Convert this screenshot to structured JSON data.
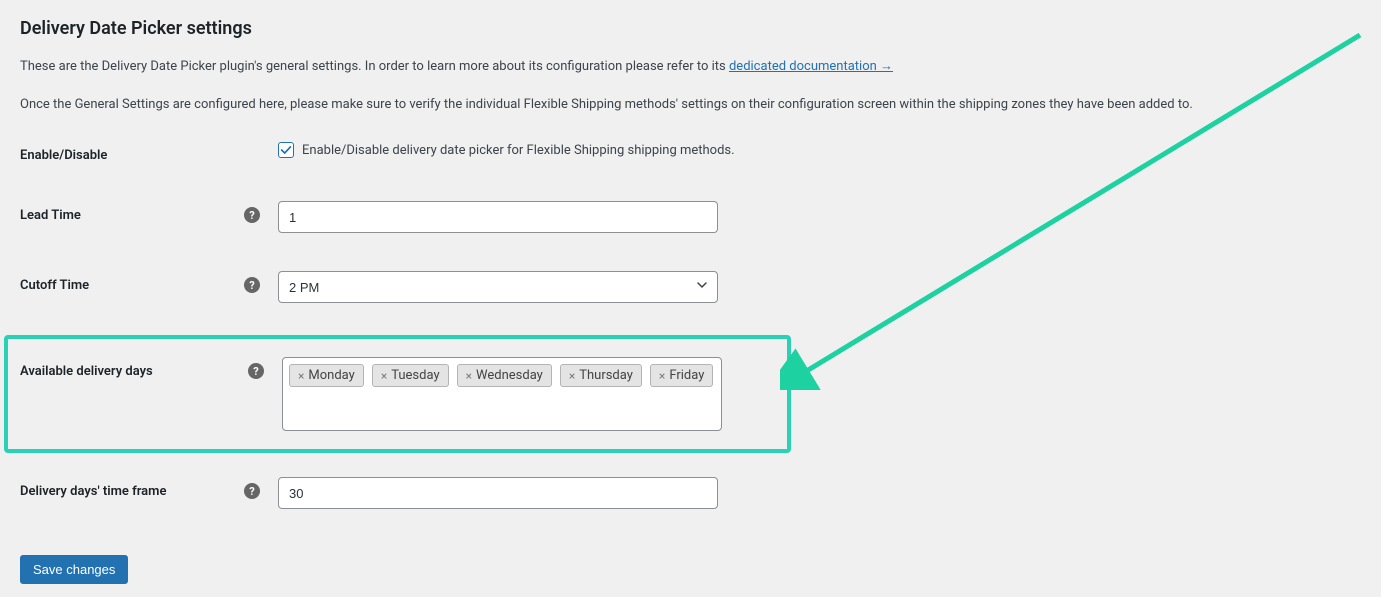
{
  "heading": "Delivery Date Picker settings",
  "desc1_a": "These are the Delivery Date Picker plugin's general settings. In order to learn more about its configuration please refer to its ",
  "desc1_link": "dedicated documentation →",
  "desc2": "Once the General Settings are configured here, please make sure to verify the individual Flexible Shipping methods' settings on their configuration screen within the shipping zones they have been added to.",
  "fields": {
    "enable": {
      "label": "Enable/Disable",
      "checkbox_label": "Enable/Disable delivery date picker for Flexible Shipping shipping methods."
    },
    "lead": {
      "label": "Lead Time",
      "value": "1"
    },
    "cutoff": {
      "label": "Cutoff Time",
      "value": "2 PM"
    },
    "days": {
      "label": "Available delivery days",
      "tags": [
        "Monday",
        "Tuesday",
        "Wednesday",
        "Thursday",
        "Friday"
      ]
    },
    "frame": {
      "label": "Delivery days' time frame",
      "value": "30"
    }
  },
  "save_button": "Save changes",
  "help_glyph": "?",
  "remove_glyph": "×"
}
